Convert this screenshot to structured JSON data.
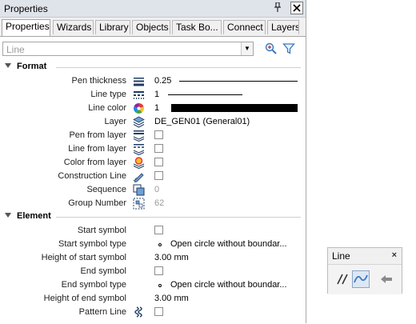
{
  "panel": {
    "title": "Properties",
    "pin_glyph": "᎘",
    "close_glyph": "✕"
  },
  "tabs": [
    {
      "label": "Properties"
    },
    {
      "label": "Wizards"
    },
    {
      "label": "Library"
    },
    {
      "label": "Objects"
    },
    {
      "label": "Task Bo..."
    },
    {
      "label": "Connect"
    },
    {
      "label": "Layers"
    }
  ],
  "filter": {
    "placeholder": "Line",
    "dropdown_glyph": "▼"
  },
  "format": {
    "title": "Format",
    "rows": {
      "pen_thickness": {
        "label": "Pen thickness",
        "value": "0.25"
      },
      "line_type": {
        "label": "Line type",
        "value": "1"
      },
      "line_color": {
        "label": "Line color",
        "value": "1",
        "swatch": "#000000"
      },
      "layer": {
        "label": "Layer",
        "value": "DE_GEN01 (General01)"
      },
      "pen_from_layer": {
        "label": "Pen from layer"
      },
      "line_from_layer": {
        "label": "Line from layer"
      },
      "color_from_layer": {
        "label": "Color from layer"
      },
      "construction_line": {
        "label": "Construction Line"
      },
      "sequence": {
        "label": "Sequence",
        "value": "0"
      },
      "group_number": {
        "label": "Group Number",
        "value": "62"
      }
    }
  },
  "element": {
    "title": "Element",
    "rows": {
      "start_symbol": {
        "label": "Start symbol"
      },
      "start_symbol_type": {
        "label": "Start symbol type",
        "value": "Open circle without boundar..."
      },
      "height_start_symbol": {
        "label": "Height of start symbol",
        "value": "3.00 mm"
      },
      "end_symbol": {
        "label": "End symbol"
      },
      "end_symbol_type": {
        "label": "End symbol type",
        "value": "Open circle without boundar..."
      },
      "height_end_symbol": {
        "label": "Height of end symbol",
        "value": "3.00 mm"
      },
      "pattern_line": {
        "label": "Pattern Line"
      }
    }
  },
  "line_toolbar": {
    "title": "Line",
    "close_glyph": "×",
    "tools": [
      "parallel-lines-icon",
      "curve-line-icon",
      "back-arrow-icon"
    ]
  },
  "colors": {
    "accent": "#3a78c2",
    "gray_text": "#9a9a9a"
  }
}
